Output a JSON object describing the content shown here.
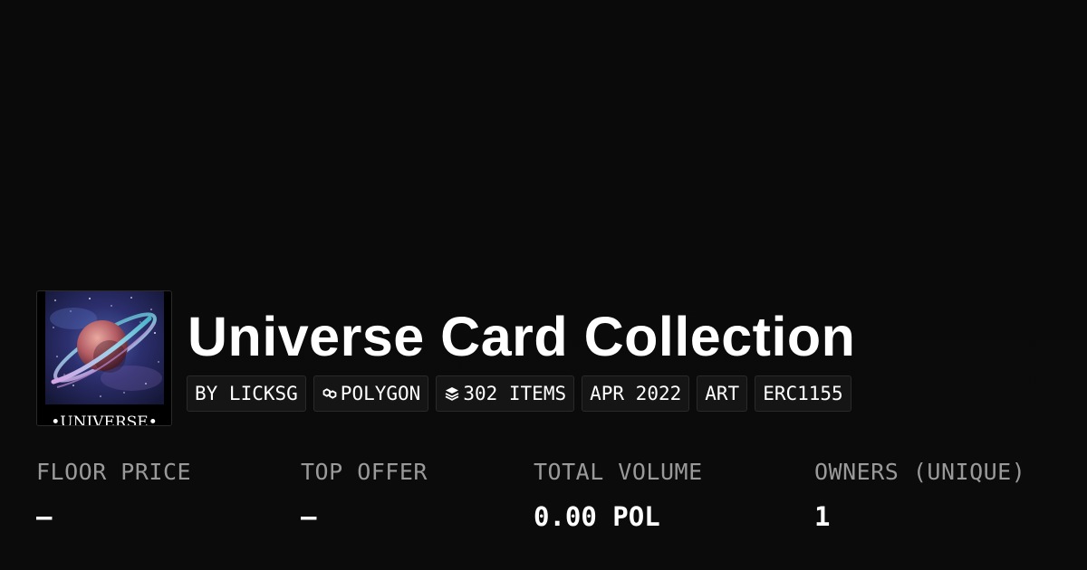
{
  "collection": {
    "title": "Universe Card Collection",
    "avatar_caption": "•UNIVERSE•"
  },
  "tags": {
    "creator": "BY LICKSG",
    "chain": "POLYGON",
    "items": "302 ITEMS",
    "date": "APR 2022",
    "category": "ART",
    "standard": "ERC1155",
    "chain_icon": "polygon-icon",
    "items_icon": "layers-icon"
  },
  "stats": {
    "floor_price": {
      "label": "FLOOR PRICE",
      "value": "–"
    },
    "top_offer": {
      "label": "TOP OFFER",
      "value": "–"
    },
    "total_volume": {
      "label": "TOTAL VOLUME",
      "value": "0.00 POL"
    },
    "owners": {
      "label": "OWNERS (UNIQUE)",
      "value": "1"
    }
  },
  "colors": {
    "background": "#0b0b0b",
    "tag_background": "#151515",
    "label_gray": "#9a9a9a",
    "text": "#ffffff"
  }
}
